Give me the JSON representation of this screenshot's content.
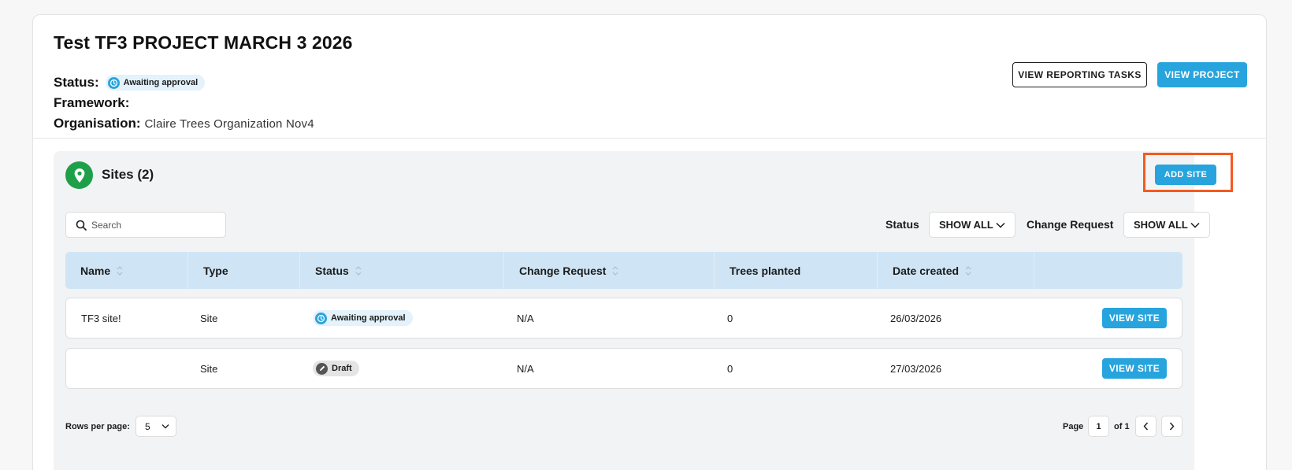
{
  "project": {
    "title": "Test TF3 PROJECT MARCH 3 2026",
    "status_label": "Status:",
    "status_value": "Awaiting approval",
    "framework_label": "Framework:",
    "framework_value": "",
    "organisation_label": "Organisation:",
    "organisation_value": "Claire Trees Organization Nov4"
  },
  "actions": {
    "view_reporting_tasks": "VIEW REPORTING TASKS",
    "view_project": "VIEW PROJECT"
  },
  "sites": {
    "title": "Sites (2)",
    "add_site": "ADD SITE",
    "search_placeholder": "Search",
    "filters": {
      "status_label": "Status",
      "status_value": "SHOW ALL",
      "change_request_label": "Change Request",
      "change_request_value": "SHOW ALL"
    },
    "columns": [
      "Name",
      "Type",
      "Status",
      "Change Request",
      "Trees planted",
      "Date created",
      ""
    ],
    "rows": [
      {
        "name": "TF3 site!",
        "type": "Site",
        "status": "Awaiting approval",
        "change_request": "N/A",
        "trees_planted": "0",
        "date_created": "26/03/2026",
        "action": "VIEW SITE"
      },
      {
        "name": "",
        "type": "Site",
        "status": "Draft",
        "change_request": "N/A",
        "trees_planted": "0",
        "date_created": "27/03/2026",
        "action": "VIEW SITE"
      }
    ]
  },
  "pagination": {
    "rows_per_page_label": "Rows per page:",
    "rows_per_page_value": "5",
    "page_label": "Page",
    "current_page": "1",
    "of_label": "of 1"
  },
  "colors": {
    "accent": "#27a4dd",
    "pin_green": "#1ea04a",
    "highlight": "#f45a1f",
    "table_header": "#cfe5f5"
  },
  "icons": {
    "status_awaiting": "clock-icon",
    "status_draft": "pencil-icon",
    "sites": "map-pin-icon",
    "search": "search-icon",
    "dropdown": "chevron-down-icon",
    "sort": "sort-icon",
    "prev": "chevron-left-icon",
    "next": "chevron-right-icon"
  }
}
